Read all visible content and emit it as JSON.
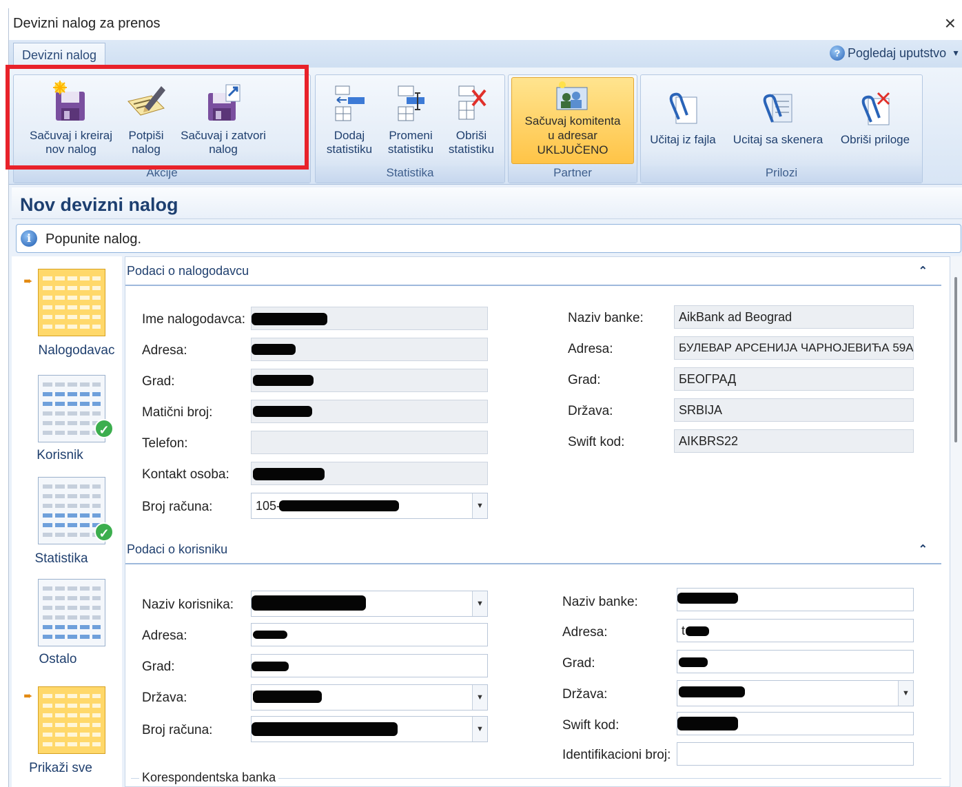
{
  "window": {
    "title": "Devizni nalog za prenos",
    "close_glyph": "×"
  },
  "tabs": {
    "active": "Devizni nalog",
    "help_label": "Pogledaj uputstvo",
    "help_icon": "help-icon"
  },
  "ribbon": {
    "akcije": {
      "label": "Akcije",
      "buttons": [
        {
          "line1": "Sačuvaj i kreiraj",
          "line2": "nov nalog"
        },
        {
          "line1": "Potpiši",
          "line2": "nalog"
        },
        {
          "line1": "Sačuvaj i zatvori",
          "line2": "nalog"
        }
      ]
    },
    "statistika": {
      "label": "Statistika",
      "buttons": [
        {
          "line1": "Dodaj",
          "line2": "statistiku"
        },
        {
          "line1": "Promeni",
          "line2": "statistiku"
        },
        {
          "line1": "Obriši",
          "line2": "statistiku"
        }
      ]
    },
    "partner": {
      "label": "Partner",
      "line1": "Sačuvaj komitenta",
      "line2": "u adresar",
      "line3": "UKLJUČENO"
    },
    "prilozi": {
      "label": "Prilozi",
      "buttons": [
        "Učitaj iz fajla",
        "Ucitaj sa skenera",
        "Obriši priloge"
      ]
    }
  },
  "page": {
    "title": "Nov devizni nalog",
    "info": "Popunite nalog."
  },
  "sidebar": {
    "items": [
      "Nalogodavac",
      "Korisnik",
      "Statistika",
      "Ostalo",
      "Prikaži sve"
    ]
  },
  "nalogodavac": {
    "section_title": "Podaci o nalogodavcu",
    "labels": {
      "ime": "Ime nalogodavca:",
      "adresa": "Adresa:",
      "grad": "Grad:",
      "maticni": "Matični broj:",
      "telefon": "Telefon:",
      "kontakt": "Kontakt osoba:",
      "racun": "Broj računa:"
    },
    "values": {
      "racun_prefix": "105-"
    },
    "bank_labels": {
      "naziv": "Naziv banke:",
      "adresa": "Adresa:",
      "grad": "Grad:",
      "drzava": "Država:",
      "swift": "Swift kod:"
    },
    "bank_values": {
      "naziv": "AikBank ad Beograd",
      "adresa": "БУЛЕВАР АРСЕНИЈА ЧАРНОЈЕВИЋА 59А",
      "grad": "БЕОГРАД",
      "drzava": "SRBIJA",
      "swift": "AIKBRS22"
    }
  },
  "korisnik": {
    "section_title": "Podaci o korisniku",
    "labels": {
      "naziv": "Naziv korisnika:",
      "adresa": "Adresa:",
      "grad": "Grad:",
      "drzava": "Država:",
      "racun": "Broj računa:"
    },
    "bank_labels": {
      "naziv": "Naziv banke:",
      "adresa": "Adresa:",
      "grad": "Grad:",
      "drzava": "Država:",
      "swift": "Swift kod:",
      "id": "Identifikacioni broj:"
    },
    "values": {
      "adresa_partial": "t"
    }
  },
  "korespondentska": {
    "title": "Korespondentska banka"
  }
}
